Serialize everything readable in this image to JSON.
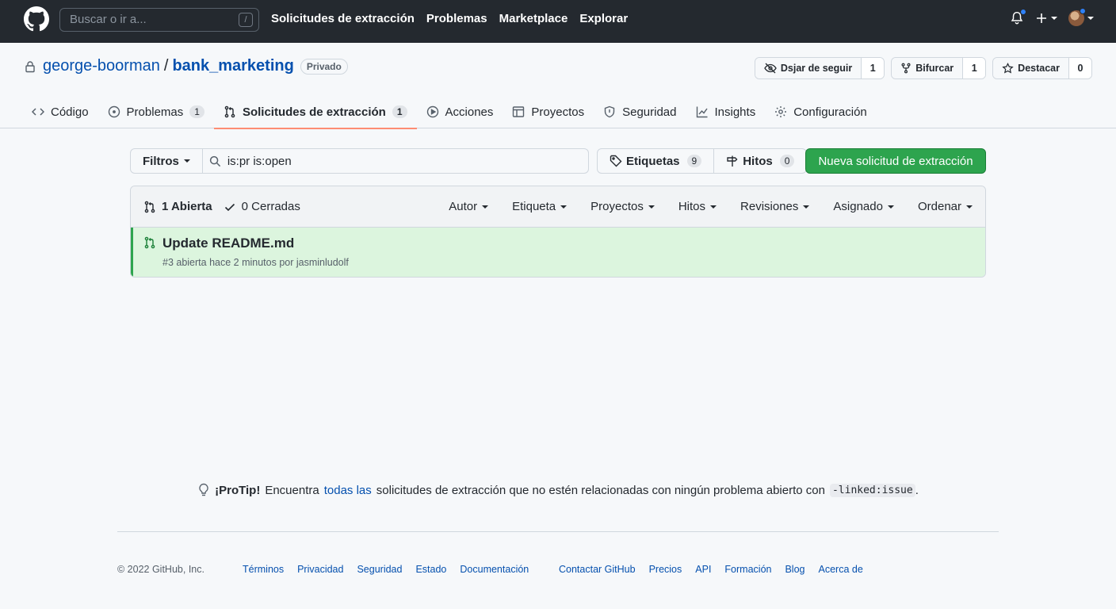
{
  "header": {
    "search_placeholder": "Buscar o ir a...",
    "slash_key": "/",
    "nav": [
      "Solicitudes de extracción",
      "Problemas",
      "Marketplace",
      "Explorar"
    ]
  },
  "repo": {
    "owner": "george-boorman",
    "separator": "/",
    "name": "bank_marketing",
    "visibility": "Privado",
    "watch_label": "Dsjar de seguir",
    "watch_count": "1",
    "fork_label": "Bifurcar",
    "fork_count": "1",
    "star_label": "Destacar",
    "star_count": "0"
  },
  "tabs": [
    {
      "label": "Código",
      "icon": "code-icon"
    },
    {
      "label": "Problemas",
      "icon": "issue-opened-icon",
      "count": "1"
    },
    {
      "label": "Solicitudes de extracción",
      "icon": "git-pull-request-icon",
      "count": "1",
      "selected": true
    },
    {
      "label": "Acciones",
      "icon": "play-icon"
    },
    {
      "label": "Proyectos",
      "icon": "table-icon"
    },
    {
      "label": "Seguridad",
      "icon": "shield-icon"
    },
    {
      "label": "Insights",
      "icon": "graph-icon"
    },
    {
      "label": "Configuración",
      "icon": "gear-icon"
    }
  ],
  "subnav": {
    "filters_label": "Filtros",
    "query": "is:pr is:open",
    "labels_label": "Etiquetas",
    "labels_count": "9",
    "milestones_label": "Hitos",
    "milestones_count": "0",
    "new_pr_label": "Nueva solicitud de extracción"
  },
  "list": {
    "open_label": "1 Abierta",
    "closed_label": "0 Cerradas",
    "sorts": [
      "Autor",
      "Etiqueta",
      "Proyectos",
      "Hitos",
      "Revisiones",
      "Asignado",
      "Ordenar"
    ],
    "items": [
      {
        "title": "Update README.md",
        "meta": "#3 abierta hace 2 minutos por jasminludolf"
      }
    ]
  },
  "protip": {
    "label": "¡ProTip!",
    "text_before": "Encuentra",
    "link": "todas las",
    "text_after": "solicitudes de extracción que no estén relacionadas con ningún problema abierto con",
    "code": "-linked:issue",
    "end": "."
  },
  "footer": {
    "copyright": "© 2022 GitHub, Inc.",
    "links_left": [
      "Términos",
      "Privacidad",
      "Seguridad",
      "Estado",
      "Documentación"
    ],
    "links_right": [
      "Contactar GitHub",
      "Precios",
      "API",
      "Formación",
      "Blog",
      "Acerca de"
    ]
  },
  "colors": {
    "header_bg": "#24292f",
    "primary_green": "#2da44e",
    "selected_tab_underline": "#fd8c73",
    "link_blue": "#0550ae",
    "open_row_bg": "#dcf5de"
  }
}
